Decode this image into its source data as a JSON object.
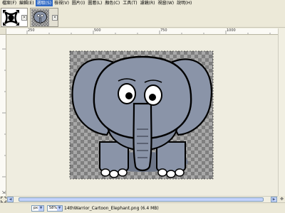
{
  "menu": [
    {
      "label": "檔案(F)",
      "active": false
    },
    {
      "label": "編輯(E)",
      "active": false
    },
    {
      "label": "選取(S)",
      "active": true
    },
    {
      "label": "檢視(V)",
      "active": false
    },
    {
      "label": "圖片(I)",
      "active": false
    },
    {
      "label": "圖層(L)",
      "active": false
    },
    {
      "label": "顏色(C)",
      "active": false
    },
    {
      "label": "工具(T)",
      "active": false
    },
    {
      "label": "濾鏡(R)",
      "active": false
    },
    {
      "label": "視窗(W)",
      "active": false
    },
    {
      "label": "說明(H)",
      "active": false
    }
  ],
  "tabs": [
    {
      "thumbnail": "ornament-thumbnail",
      "close_label": "×"
    },
    {
      "thumbnail": "elephant-thumbnail",
      "close_label": "×"
    }
  ],
  "ruler_top_labels": [
    "250",
    "500",
    "750",
    "1000"
  ],
  "status": {
    "unit": "px",
    "zoom": "58%",
    "info": "14thWarrior_Cartoon_Elephant.png (6.4 MB)"
  },
  "colors": {
    "accent": "#316ac5",
    "elephant_body": "#8a94a8",
    "elephant_shadow": "#6e7789",
    "checker_dark": "#7f7f7f",
    "checker_light": "#a8a8a8"
  }
}
